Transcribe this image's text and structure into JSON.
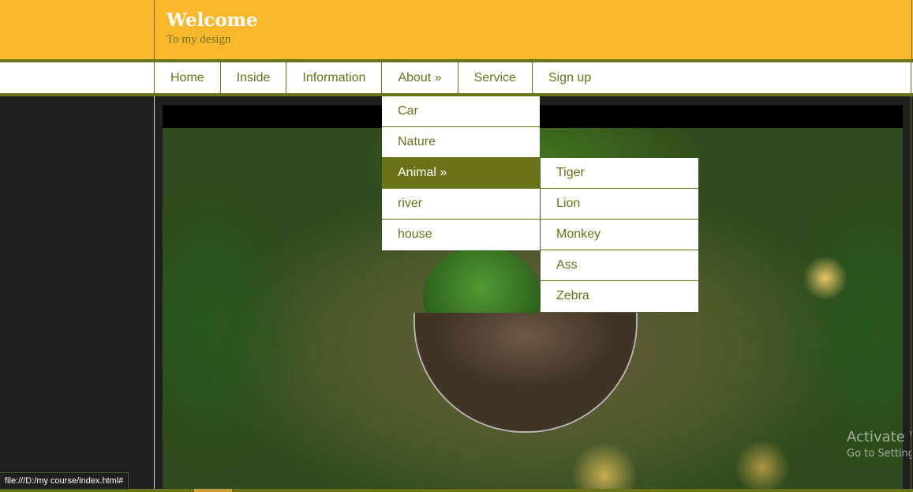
{
  "header": {
    "title": "Welcome",
    "subtitle": "To my design"
  },
  "nav": {
    "items": [
      {
        "label": "Home"
      },
      {
        "label": "Inside"
      },
      {
        "label": "Information"
      },
      {
        "label": "About »"
      },
      {
        "label": "Service"
      },
      {
        "label": "Sign up"
      }
    ]
  },
  "about_menu": {
    "items": [
      {
        "label": "Car"
      },
      {
        "label": "Nature"
      },
      {
        "label": "Animal »",
        "active": true
      },
      {
        "label": "river"
      },
      {
        "label": "house"
      }
    ]
  },
  "animal_submenu": {
    "items": [
      {
        "label": "Tiger"
      },
      {
        "label": "Lion"
      },
      {
        "label": "Monkey"
      },
      {
        "label": "Ass"
      },
      {
        "label": "Zebra"
      }
    ]
  },
  "watermark": {
    "title": "Activate W",
    "subtitle": "Go to Setting"
  },
  "status_bar": {
    "url": "file:///D:/my course/index.html#"
  },
  "colors": {
    "header_bg": "#fab82c",
    "accent": "#6a7317",
    "background": "#1f1f1f"
  }
}
